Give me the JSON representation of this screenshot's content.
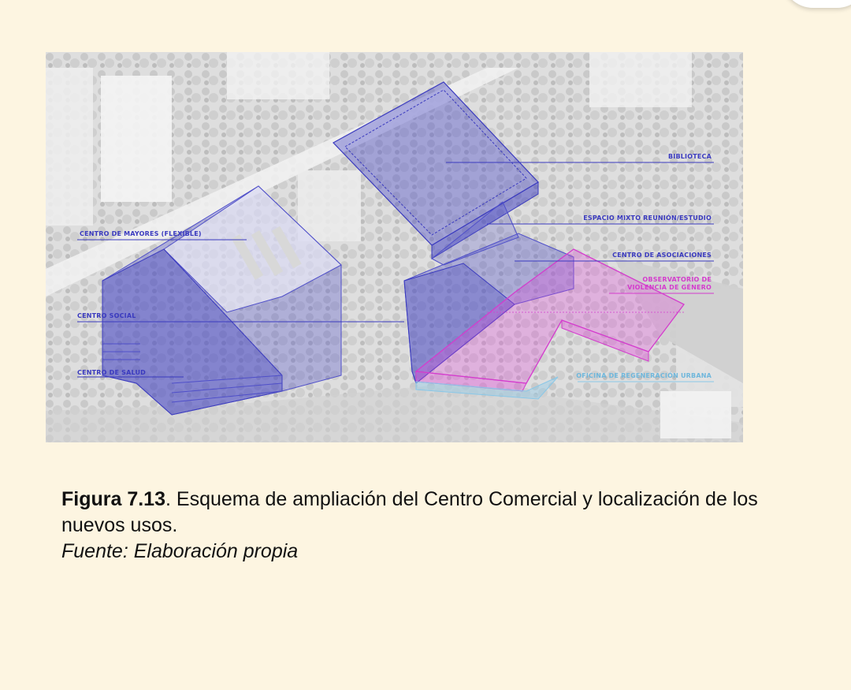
{
  "figure": {
    "labels": {
      "biblioteca": "BIBLIOTECA",
      "espacio_mixto": "ESPACIO MIXTO REUNIÓN/ESTUDIO",
      "centro_mayores": "CENTRO DE MAYORES (FLEXIBLE)",
      "centro_asociaciones": "CENTRO DE ASOCIACIONES",
      "observatorio_1": "OBSERVATORIO DE",
      "observatorio_2": "VIOLENCIA DE GÉNERO",
      "centro_social": "CENTRO SOCIAL",
      "centro_salud": "CENTRO DE SALUD",
      "oficina": "OFICINA DE REGENERACIÓN URBANA"
    },
    "colors": {
      "blue": "#4f4fc9",
      "magenta": "#e04ad9",
      "lightblue": "#8ac8e8"
    }
  },
  "caption": {
    "number": "Figura 7.13",
    "text": ". Esquema de ampliación del Centro Comercial y localización de los nuevos usos.",
    "source": "Fuente: Elaboración propia"
  }
}
